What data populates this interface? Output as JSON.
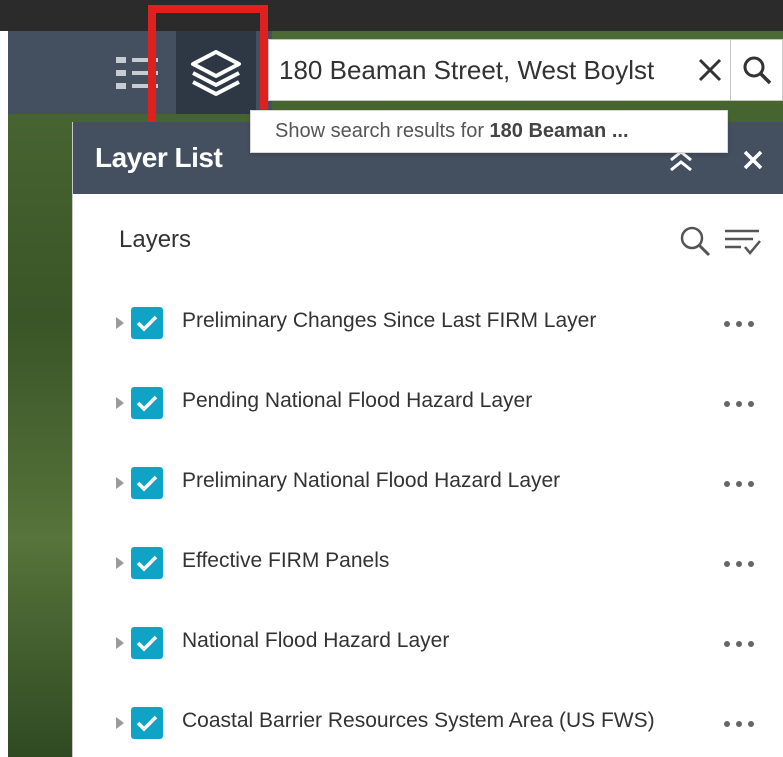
{
  "search": {
    "value": "180 Beaman Street, West Boylst",
    "suggestion_prefix": "Show search results for ",
    "suggestion_bold": "180 Beaman ..."
  },
  "panel": {
    "title": "Layer List",
    "layers_heading": "Layers"
  },
  "layers": [
    {
      "label": "Preliminary Changes Since Last FIRM Layer",
      "checked": true
    },
    {
      "label": "Pending National Flood Hazard Layer",
      "checked": true
    },
    {
      "label": "Preliminary National Flood Hazard Layer",
      "checked": true
    },
    {
      "label": "Effective FIRM Panels",
      "checked": true
    },
    {
      "label": "National Flood Hazard Layer",
      "checked": true
    },
    {
      "label": "Coastal Barrier Resources System Area (US FWS)",
      "checked": true
    }
  ],
  "icons": {
    "toolbar": [
      "list-icon",
      "layers-icon"
    ],
    "search": [
      "clear-icon",
      "search-icon"
    ],
    "panel": [
      "collapse-icon",
      "close-icon",
      "search-icon",
      "filter-icon",
      "expand-arrow-icon",
      "check-icon",
      "more-icon"
    ]
  },
  "colors": {
    "toolbar": "#44505f",
    "toolbar_active": "#2e3744",
    "highlight": "#e01f1f",
    "checkbox": "#0fa4c6",
    "header": "#44505f"
  }
}
